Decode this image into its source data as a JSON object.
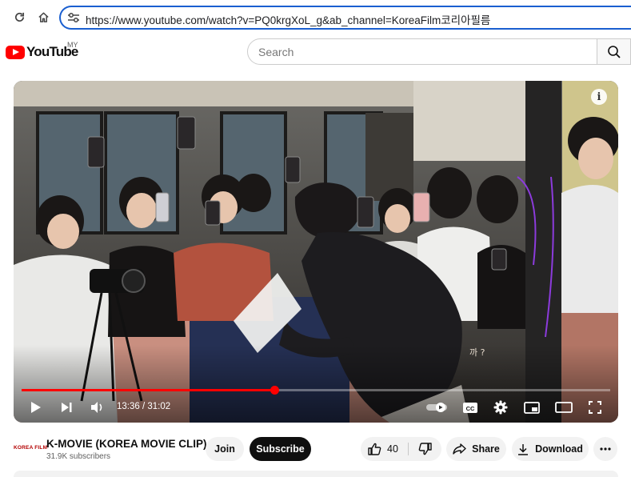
{
  "browser": {
    "url": "https://www.youtube.com/watch?v=PQ0krgXoL_g&ab_channel=KoreaFilm코리아필름"
  },
  "header": {
    "logo_text": "YouTube",
    "region": "MY",
    "search_placeholder": "Search"
  },
  "player": {
    "current_time": "13:36",
    "duration": "31:02",
    "time_separator": " / ",
    "progress": 0.43,
    "caption_fragment": "까 ?",
    "info_label": "i"
  },
  "video_meta": {
    "channel_logo_text": "KOREA FILM",
    "channel_name": "K-MOVIE (KOREA MOVIE CLIP)",
    "subscribers": "31.9K subscribers",
    "join_label": "Join",
    "subscribe_label": "Subscribe",
    "like_count": "40",
    "share_label": "Share",
    "download_label": "Download"
  },
  "colors": {
    "accent": "#ff0000",
    "url_border": "#1a5fd0"
  },
  "icons": [
    "reload-icon",
    "home-icon",
    "site-settings-icon",
    "search-icon",
    "info-icon",
    "play-icon",
    "next-icon",
    "volume-icon",
    "autoplay-toggle",
    "captions-icon",
    "settings-gear-icon",
    "miniplayer-icon",
    "theater-icon",
    "fullscreen-icon",
    "thumbs-up-icon",
    "thumbs-down-icon",
    "share-icon",
    "download-icon",
    "more-icon"
  ]
}
